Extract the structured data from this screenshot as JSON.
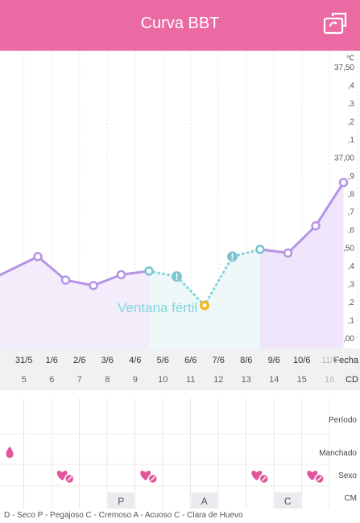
{
  "header": {
    "title": "Curva BBT",
    "background": "#eb6aa3",
    "rotate_icon": "rotate-screen-icon"
  },
  "chart_data": {
    "type": "line",
    "unit": "℃",
    "ylim": [
      36.0,
      37.5
    ],
    "y_tick_labels": [
      "37,50",
      ",4",
      ",3",
      ",2",
      ",1",
      "37,00",
      ",9",
      ",8",
      ",7",
      ",6",
      "36,50",
      ",4",
      ",3",
      ",2",
      ",1",
      "36,00"
    ],
    "fertile_window_label": "Ventana fértil",
    "dates": [
      "31/5",
      "1/6",
      "2/6",
      "3/6",
      "4/6",
      "5/6",
      "6/6",
      "7/6",
      "8/6",
      "9/6",
      "10/6",
      "11/6"
    ],
    "cd": [
      "5",
      "6",
      "7",
      "8",
      "9",
      "10",
      "11",
      "12",
      "13",
      "14",
      "15",
      "16"
    ],
    "series": [
      {
        "values": [
          36.33,
          36.45,
          36.32,
          36.29,
          36.35,
          36.37,
          36.34,
          36.18,
          36.45,
          36.49,
          36.47,
          36.62,
          36.86
        ],
        "x_index": [
          -0.6,
          1,
          2,
          3,
          4,
          5,
          6,
          7,
          8,
          9,
          10,
          11,
          12
        ]
      }
    ],
    "line_color": "#b594e6",
    "fertile_color": "#7fd6dd",
    "ovulation_color": "#f5b822"
  },
  "date_table": {
    "fecha_label": "Fecha",
    "cd_label": "CD"
  },
  "grid": {
    "row_labels": [
      "Período",
      "Manchado",
      "Sexo",
      "CM"
    ],
    "spotting_col": 0,
    "sex_cols": [
      1,
      4,
      8,
      10,
      11
    ],
    "cm_marks": [
      {
        "col": 3,
        "text": "P"
      },
      {
        "col": 6,
        "text": "A"
      },
      {
        "col": 9,
        "text": "C"
      }
    ],
    "heart_color": "#e0559b"
  },
  "legend": "D - Seco P - Pegajoso C - Cremoso A - Acuoso C - Clara de Huevo"
}
